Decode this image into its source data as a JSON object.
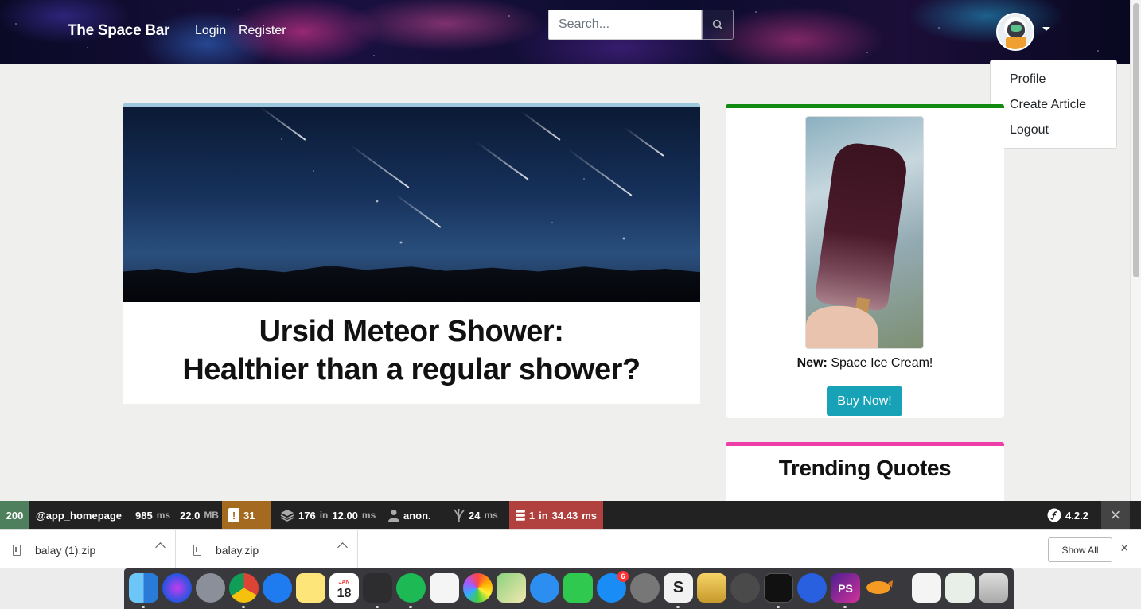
{
  "navbar": {
    "brand": "The Space Bar",
    "login": "Login",
    "register": "Register",
    "search_placeholder": "Search...",
    "search_icon": "search-icon",
    "avatar_icon": "astronaut-avatar"
  },
  "dropdown": {
    "items": [
      {
        "label": "Profile"
      },
      {
        "label": "Create Article"
      },
      {
        "label": "Logout"
      }
    ]
  },
  "article": {
    "title_line1": "Ursid Meteor Shower:",
    "title_line2": "Healthier than a regular shower?",
    "accent_color": "#9dc7dd"
  },
  "ad": {
    "new_label": "New:",
    "product": "Space Ice Cream!",
    "button_label": "Buy Now!",
    "accent_color": "#108a10",
    "button_color": "#17a2b8"
  },
  "quotes": {
    "title": "Trending Quotes",
    "accent_color": "#ee3fa8"
  },
  "symfony_toolbar": {
    "status": "200",
    "route_prefix": "@",
    "route": "app_homepage",
    "time_value": "985",
    "time_unit": "ms",
    "memory_value": "22.0",
    "memory_unit": "MB",
    "warnings_icon": "!",
    "warnings": "31",
    "forms_value": "176",
    "forms_in": "in",
    "forms_time": "12.00",
    "forms_unit": "ms",
    "user": "anon.",
    "twig_value": "24",
    "twig_unit": "ms",
    "db_queries": "1",
    "db_in": "in",
    "db_time": "34.43",
    "db_unit": "ms",
    "version": "4.2.2",
    "close_icon": "×"
  },
  "downloads": {
    "files": [
      {
        "name": "balay (1).zip"
      },
      {
        "name": "balay.zip"
      }
    ],
    "show_all": "Show All",
    "close_icon": "×"
  },
  "dock": {
    "calendar_month": "JAN",
    "calendar_day": "18",
    "appstore_badge": "6",
    "ps_label": "PS",
    "sublime_label": "S"
  }
}
